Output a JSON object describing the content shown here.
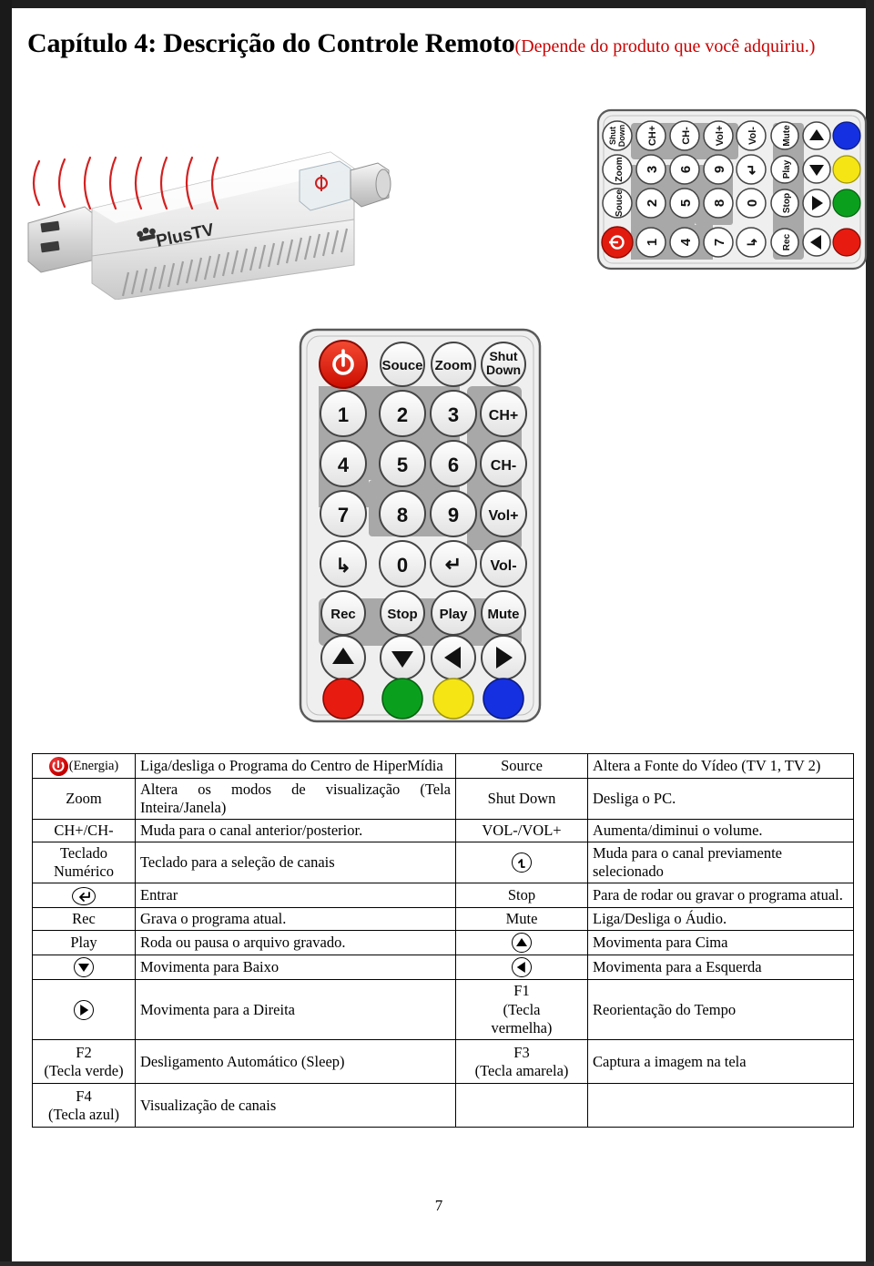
{
  "document": {
    "title_main": "Capítulo 4: Descrição do Controle Remoto",
    "title_note": "(Depende do produto que você adquiriu.)",
    "page_number": "7",
    "title_note_color": "#cc0000"
  },
  "figures": {
    "usb_dongle": {
      "name": "usb-tv-tuner-stick",
      "brand_label": "PlusTV",
      "ir_wave_color": "#d32020"
    },
    "remote_vertical": {
      "name": "remote-control-front-view",
      "rows": [
        [
          "power",
          "Souce",
          "Zoom",
          "Shut\nDown"
        ],
        [
          "1",
          "2",
          "3",
          "CH+"
        ],
        [
          "4",
          "5",
          "6",
          "CH-"
        ],
        [
          "7",
          "8",
          "9",
          "Vol+"
        ],
        [
          "L",
          "0",
          "enter",
          "Vol-"
        ],
        [
          "Rec",
          "Stop",
          "Play",
          "Mute"
        ],
        [
          "up",
          "down",
          "left",
          "right"
        ],
        [
          "red",
          "green",
          "yellow",
          "blue"
        ]
      ],
      "color_keys": [
        "#e81b10",
        "#0aa01e",
        "#f5e514",
        "#1530e0"
      ],
      "power_color": "#e81b10",
      "body_color": "#efefef",
      "pad_color": "#a8a8a8"
    },
    "remote_horizontal": {
      "name": "remote-control-rotated-view",
      "note": "same remote rotated 90 degrees counter-clockwise"
    }
  },
  "table": {
    "rows": [
      {
        "c1": {
          "icon": "power-red",
          "text": "(Energia)"
        },
        "c2": {
          "text": "Liga/desliga o Programa do Centro de HiperMídia"
        },
        "c3": {
          "text": "Source"
        },
        "c4": {
          "text": "Altera a Fonte do Vídeo (TV 1, TV 2)"
        }
      },
      {
        "c1": {
          "text": "Zoom"
        },
        "c2": {
          "text": "Altera os modos de visualização (Tela Inteira/Janela)"
        },
        "c3": {
          "text": "Shut Down"
        },
        "c4": {
          "text": "Desliga o PC."
        }
      },
      {
        "c1": {
          "text": "CH+/CH-"
        },
        "c2": {
          "text": "Muda para o canal anterior/posterior."
        },
        "c3": {
          "text": "VOL-/VOL+"
        },
        "c4": {
          "text": "Aumenta/diminui o volume."
        }
      },
      {
        "c1": {
          "text": "Teclado Numérico"
        },
        "c2": {
          "text": "Teclado para a seleção de canais"
        },
        "c3": {
          "icon": "last-channel-circle"
        },
        "c4": {
          "text": "Muda para o canal previamente selecionado"
        }
      },
      {
        "c1": {
          "icon": "enter-circle"
        },
        "c2": {
          "text": "Entrar"
        },
        "c3": {
          "text": "Stop"
        },
        "c4": {
          "text": "Para de rodar ou gravar o programa atual."
        }
      },
      {
        "c1": {
          "text": "Rec"
        },
        "c2": {
          "text": "Grava o programa atual."
        },
        "c3": {
          "text": "Mute"
        },
        "c4": {
          "text": "Liga/Desliga o Áudio."
        }
      },
      {
        "c1": {
          "text": "Play"
        },
        "c2": {
          "text": "Roda ou pausa o arquivo gravado."
        },
        "c3": {
          "icon": "arrow-up-circle"
        },
        "c4": {
          "text": "Movimenta para Cima"
        }
      },
      {
        "c1": {
          "icon": "arrow-down-circle"
        },
        "c2": {
          "text": "Movimenta para Baixo"
        },
        "c3": {
          "icon": "arrow-left-circle"
        },
        "c4": {
          "text": "Movimenta para a Esquerda"
        }
      },
      {
        "c1": {
          "icon": "arrow-right-circle"
        },
        "c2": {
          "text": "Movimenta para a Direita"
        },
        "c3": {
          "text": "F1 (Tecla vermelha)"
        },
        "c4": {
          "text": "Reorientação do Tempo"
        }
      },
      {
        "c1": {
          "text": "F2 (Tecla verde)"
        },
        "c2": {
          "text": "Desligamento Automático (Sleep)"
        },
        "c3": {
          "text": "F3 (Tecla amarela)"
        },
        "c4": {
          "text": "Captura a imagem na tela"
        }
      },
      {
        "c1": {
          "text": "F4 (Tecla azul)"
        },
        "c2": {
          "text": "Visualização de canais"
        },
        "c3": {
          "text": ""
        },
        "c4": {
          "text": ""
        }
      }
    ],
    "cell_lines": {
      "r1c1_b": "(Energia)",
      "r4c1_a": "Teclado",
      "r4c1_b": "Numérico",
      "r9c3_a": "F1",
      "r9c3_b": "(Tecla",
      "r9c3_c": "vermelha)",
      "r10c1_a": "F2",
      "r10c1_b": "(Tecla verde)",
      "r10c3_a": "F3",
      "r10c3_b": "(Tecla amarela)",
      "r11c1_a": "F4",
      "r11c1_b": "(Tecla azul)"
    }
  }
}
